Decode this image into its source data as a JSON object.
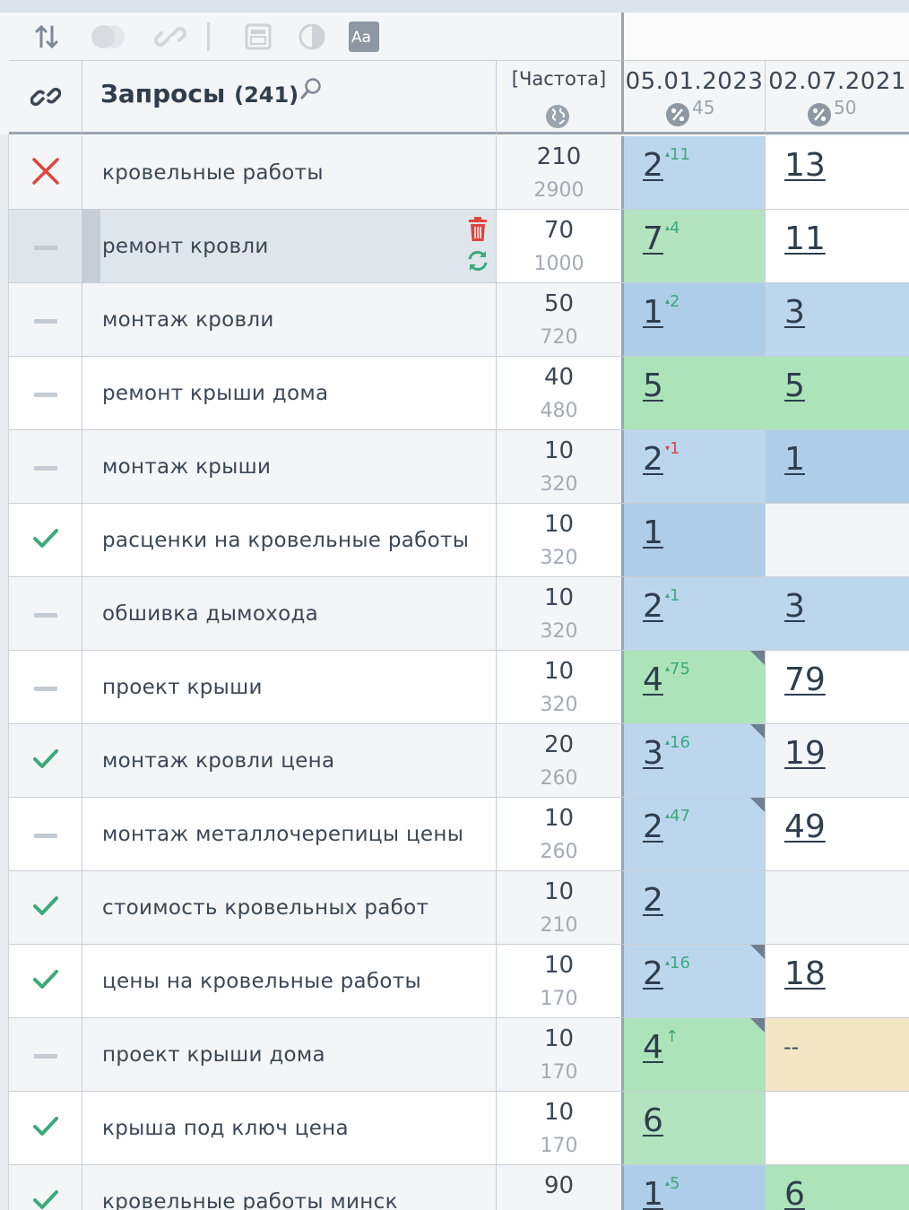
{
  "toolbar": {
    "icons": [
      "sort-icon",
      "toggle-icon",
      "link-icon",
      "calendar-icon",
      "contrast-icon",
      "font-icon"
    ],
    "font_icon_text": "Aa"
  },
  "header": {
    "queries_title": "Запросы",
    "queries_count": "(241)",
    "frequency_label": "[Частота]",
    "dates": [
      {
        "date": "05.01.2023",
        "pct": "45"
      },
      {
        "date": "02.07.2021",
        "pct": "50"
      }
    ]
  },
  "colors": {
    "blue": "#bcd6ee",
    "green": "#b3e3bf",
    "cream": "#f2e6c4",
    "red_x": "#e0443c",
    "check": "#3aaa7a"
  },
  "rows": [
    {
      "status": "x",
      "query": "кровельные работы",
      "f1": "210",
      "f2": "2900",
      "p1": "2",
      "c1": "11",
      "c1dir": "up",
      "p1bg": "blue",
      "p2": "13",
      "p2bg": "white"
    },
    {
      "status": "dash",
      "query": "ремонт кровли",
      "f1": "70",
      "f2": "1000",
      "p1": "7",
      "c1": "4",
      "c1dir": "up",
      "p1bg": "green",
      "p2": "11",
      "p2bg": "white",
      "selected": true
    },
    {
      "status": "dash",
      "query": "монтаж кровли",
      "f1": "50",
      "f2": "720",
      "p1": "1",
      "c1": "2",
      "c1dir": "up",
      "p1bg": "blue2",
      "p2": "3",
      "p2bg": "blue"
    },
    {
      "status": "dash",
      "query": "ремонт крыши дома",
      "f1": "40",
      "f2": "480",
      "p1": "5",
      "c1": "",
      "c1dir": "",
      "p1bg": "green2",
      "p2": "5",
      "p2bg": "green2"
    },
    {
      "status": "dash",
      "query": "монтаж крыши",
      "f1": "10",
      "f2": "320",
      "p1": "2",
      "c1": "1",
      "c1dir": "down",
      "p1bg": "blue",
      "p2": "1",
      "p2bg": "blue2"
    },
    {
      "status": "check",
      "query": "расценки на кровельные работы",
      "f1": "10",
      "f2": "320",
      "p1": "1",
      "c1": "",
      "c1dir": "",
      "p1bg": "blue2",
      "p2": "",
      "p2bg": "grey"
    },
    {
      "status": "dash",
      "query": "обшивка дымохода",
      "f1": "10",
      "f2": "320",
      "p1": "2",
      "c1": "1",
      "c1dir": "up",
      "p1bg": "blue",
      "p2": "3",
      "p2bg": "blue"
    },
    {
      "status": "dash",
      "query": "проект крыши",
      "f1": "10",
      "f2": "320",
      "p1": "4",
      "c1": "75",
      "c1dir": "up",
      "p1bg": "green2",
      "p2": "79",
      "p2bg": "white",
      "corner": true
    },
    {
      "status": "check",
      "query": "монтаж кровли цена",
      "f1": "20",
      "f2": "260",
      "p1": "3",
      "c1": "16",
      "c1dir": "up",
      "p1bg": "blue",
      "p2": "19",
      "p2bg": "grey",
      "corner": true
    },
    {
      "status": "dash",
      "query": "монтаж металлочерепицы цены",
      "f1": "10",
      "f2": "260",
      "p1": "2",
      "c1": "47",
      "c1dir": "up",
      "p1bg": "blue",
      "p2": "49",
      "p2bg": "white",
      "corner": true
    },
    {
      "status": "check",
      "query": "стоимость кровельных работ",
      "f1": "10",
      "f2": "210",
      "p1": "2",
      "c1": "",
      "c1dir": "",
      "p1bg": "blue",
      "p2": "",
      "p2bg": "grey"
    },
    {
      "status": "check",
      "query": "цены на кровельные работы",
      "f1": "10",
      "f2": "170",
      "p1": "2",
      "c1": "16",
      "c1dir": "up",
      "p1bg": "blue",
      "p2": "18",
      "p2bg": "white",
      "corner": true
    },
    {
      "status": "dash",
      "query": "проект крыши дома",
      "f1": "10",
      "f2": "170",
      "p1": "4",
      "c1": "↑",
      "c1dir": "up",
      "p1bg": "green2",
      "p2": "--",
      "p2bg": "cream",
      "corner": true,
      "p2dash": true
    },
    {
      "status": "check",
      "query": "крыша под ключ цена",
      "f1": "10",
      "f2": "170",
      "p1": "6",
      "c1": "",
      "c1dir": "",
      "p1bg": "green",
      "p2": "",
      "p2bg": "white"
    },
    {
      "status": "check",
      "query": "кровельные работы минск",
      "f1": "90",
      "f2": "",
      "p1": "1",
      "c1": "5",
      "c1dir": "up",
      "p1bg": "blue2",
      "p2": "6",
      "p2bg": "green2"
    }
  ]
}
